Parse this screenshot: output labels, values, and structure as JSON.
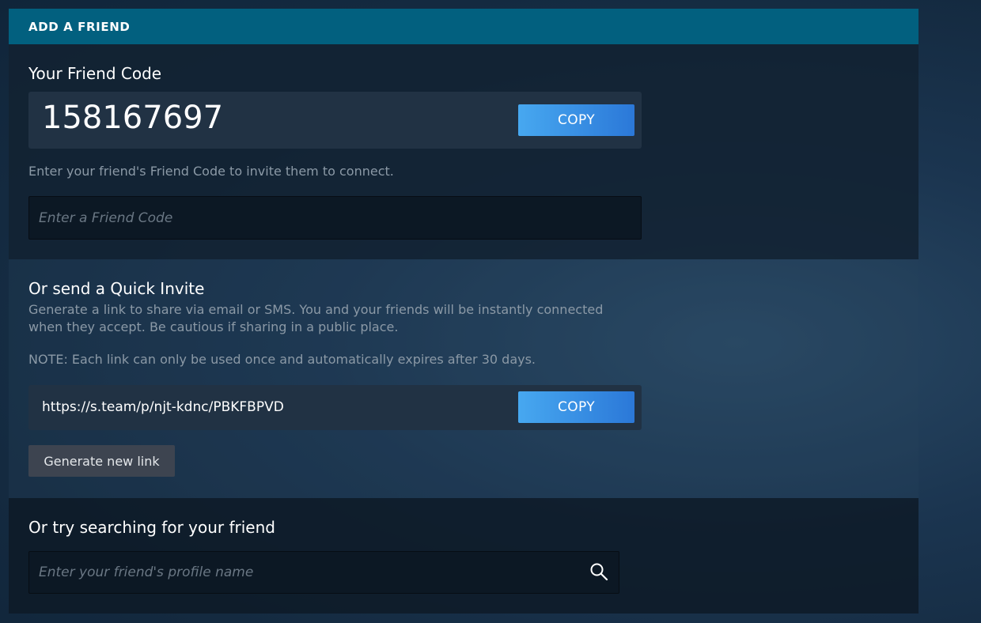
{
  "header": {
    "title": "ADD A FRIEND"
  },
  "friend_code": {
    "heading": "Your Friend Code",
    "code": "158167697",
    "copy_label": "COPY",
    "invite_text": "Enter your friend's Friend Code to invite them to connect.",
    "input_placeholder": "Enter a Friend Code"
  },
  "quick_invite": {
    "heading": "Or send a Quick Invite",
    "description_line1": "Generate a link to share via email or SMS. You and your friends will be instantly connected",
    "description_line2": "when they accept. Be cautious if sharing in a public place.",
    "note": "NOTE: Each link can only be used once and automatically expires after 30 days.",
    "link": "https://s.team/p/njt-kdnc/PBKFBPVD",
    "copy_label": "COPY",
    "generate_label": "Generate new link"
  },
  "search": {
    "heading": "Or try searching for your friend",
    "input_placeholder": "Enter your friend's profile name",
    "icon": "search-icon"
  },
  "colors": {
    "header_bg": "#02607f",
    "copy_button_start": "#47a8f0",
    "copy_button_end": "#2b78d8",
    "generate_button_bg": "#3d4450"
  }
}
